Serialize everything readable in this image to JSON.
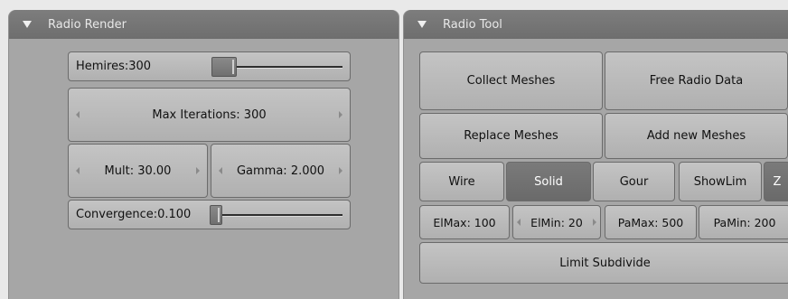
{
  "radio_render": {
    "title": "Radio Render",
    "hemires_label": "Hemires:300",
    "max_iterations_label": "Max Iterations: 300",
    "mult_label": "Mult: 30.00",
    "gamma_label": "Gamma: 2.000",
    "convergence_label": "Convergence:0.100"
  },
  "radio_tool": {
    "title": "Radio Tool",
    "collect_meshes": "Collect Meshes",
    "free_radio_data": "Free Radio Data",
    "replace_meshes": "Replace Meshes",
    "add_new_meshes": "Add new Meshes",
    "display_modes": [
      "Wire",
      "Solid",
      "Gour"
    ],
    "selected_display_mode": "Solid",
    "show_lim": "ShowLim",
    "z_label": "Z",
    "elmax": "ElMax: 100",
    "elmin": "ElMin: 20",
    "pamax": "PaMax: 500",
    "pamin": "PaMin: 200",
    "limit_subdivide": "Limit Subdivide"
  }
}
